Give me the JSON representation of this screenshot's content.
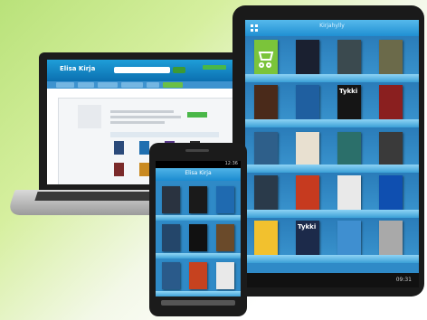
{
  "laptop": {
    "logo": "Elisa Kirja",
    "screen_bg": "#ffffff",
    "header_color": "#0b6fb0"
  },
  "tablet": {
    "title": "Kirjahylly",
    "status_time": "09:31",
    "book_titles": [
      "Tykki",
      "Tykki"
    ]
  },
  "phone": {
    "title": "Elisa Kirja",
    "status_time": "12:36"
  },
  "colors": {
    "shelf_blue": "#2f8ac7",
    "accent_green": "#7fd14a",
    "background_green": "#b9e27a"
  }
}
